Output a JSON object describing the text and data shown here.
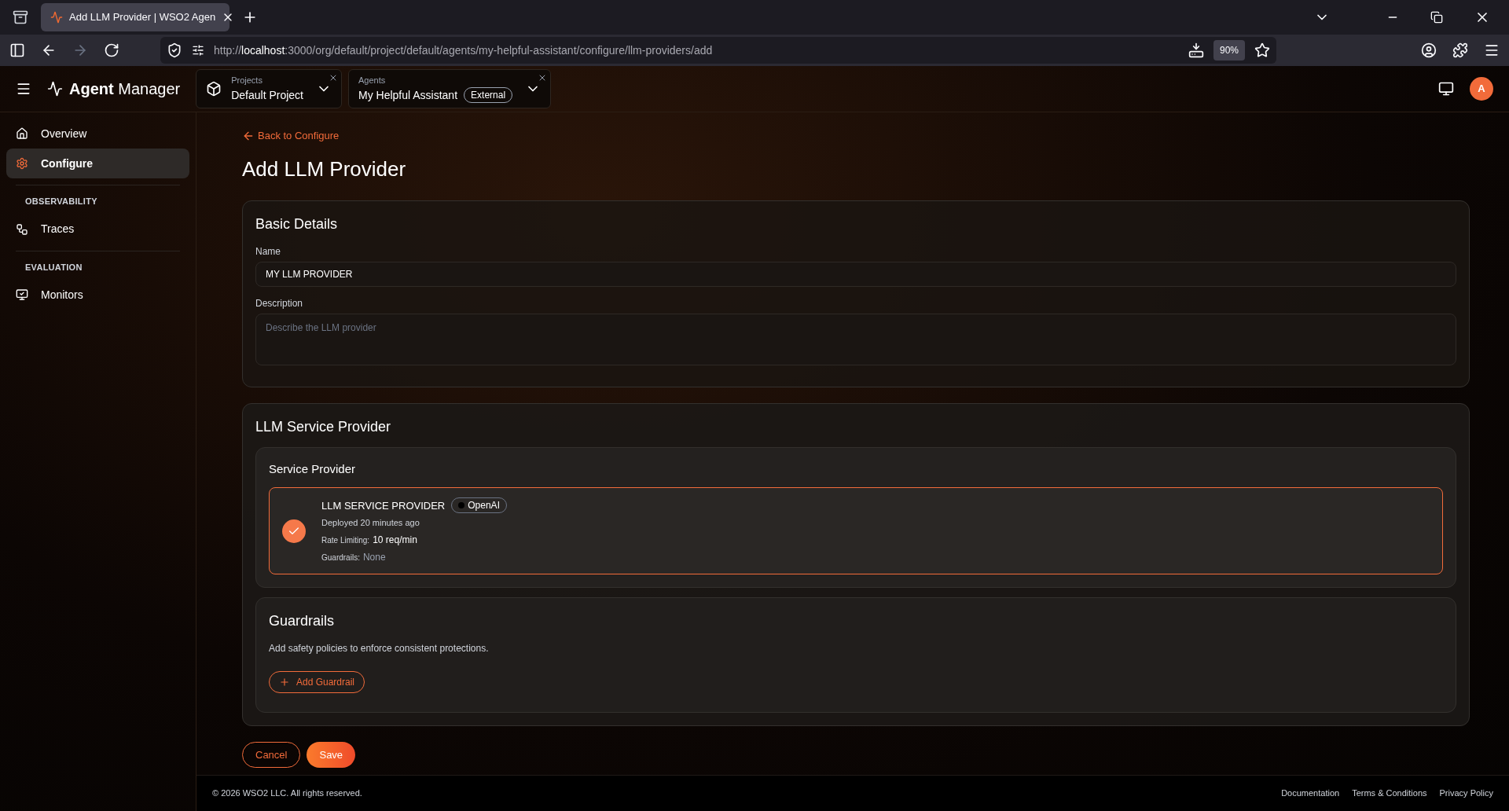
{
  "browser": {
    "tab_title": "Add LLM Provider | WSO2 Agen",
    "url": "http://**localhost**:3000/org/default/project/default/agents/my-helpful-assistant/configure/llm-providers/add",
    "zoom": "90%"
  },
  "header": {
    "app_title": "**Agent** Manager",
    "selectors": [
      {
        "label": "Projects",
        "value": "Default Project"
      },
      {
        "label": "Agents",
        "value": "My Helpful Assistant",
        "badge": "External"
      }
    ],
    "avatar": "A"
  },
  "sidebar": {
    "sections": [
      {
        "items": [
          {
            "label": "Overview",
            "kind": "home",
            "selected": false
          },
          {
            "label": "Configure",
            "kind": "settings",
            "selected": true
          }
        ]
      },
      {
        "title": "OBSERVABILITY",
        "items": [
          {
            "label": "Traces",
            "kind": "traces",
            "selected": false
          }
        ]
      },
      {
        "title": "EVALUATION",
        "items": [
          {
            "label": "Monitors",
            "kind": "monitor",
            "selected": false
          }
        ]
      }
    ]
  },
  "page": {
    "back_link": "Back to Configure",
    "title": "Add LLM Provider",
    "basic_details": {
      "title": "Basic Details",
      "fields": [
        {
          "label": "Name",
          "value": "MY LLM PROVIDER",
          "kind": "input"
        },
        {
          "label": "Description",
          "placeholder": "Describe the LLM provider",
          "kind": "textarea"
        }
      ]
    },
    "llm_service": {
      "title": "LLM Service Provider",
      "service_provider": {
        "title": "Service Provider",
        "cards": [
          {
            "selected": true,
            "name": "LLM SERVICE PROVIDER",
            "badge": "OpenAI",
            "deployed": "Deployed 20 minutes ago",
            "rate_label": "Rate Limiting:",
            "rate_value": "10 req/min",
            "guardrails_label": "Guardrails:",
            "guardrails_value": "None"
          }
        ]
      },
      "guardrails": {
        "title": "Guardrails",
        "description": "Add safety policies to enforce consistent protections.",
        "button": "Add Guardrail"
      }
    },
    "actions": {
      "cancel": "Cancel",
      "save": "Save"
    }
  },
  "footer": {
    "copyright": "© 2026 WSO2 LLC. All rights reserved.",
    "links": [
      "Documentation",
      "Terms & Conditions",
      "Privacy Policy"
    ]
  }
}
